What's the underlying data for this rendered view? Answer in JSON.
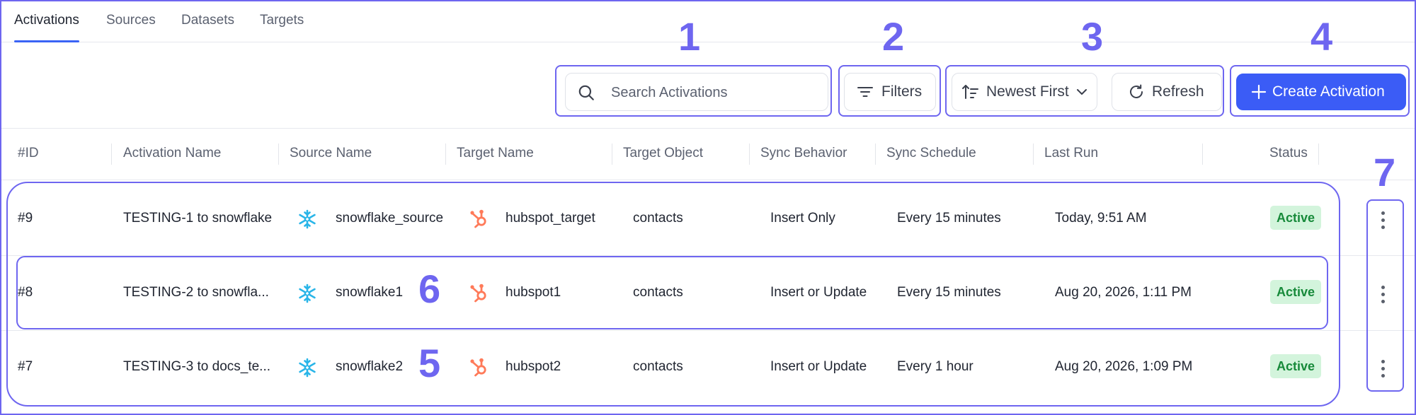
{
  "tabs": [
    {
      "label": "Activations",
      "active": true
    },
    {
      "label": "Sources",
      "active": false
    },
    {
      "label": "Datasets",
      "active": false
    },
    {
      "label": "Targets",
      "active": false
    }
  ],
  "toolbar": {
    "search_placeholder": "Search Activations",
    "filters_label": "Filters",
    "sort_label": "Newest First",
    "refresh_label": "Refresh",
    "create_label": "Create Activation"
  },
  "annotations": [
    "1",
    "2",
    "3",
    "4",
    "5",
    "6",
    "7"
  ],
  "table": {
    "columns": [
      "#ID",
      "Activation Name",
      "Source Name",
      "Target Name",
      "Target Object",
      "Sync Behavior",
      "Sync Schedule",
      "Last Run",
      "Status"
    ],
    "rows": [
      {
        "id": "#9",
        "name": "TESTING-1 to snowflake",
        "source": "snowflake_source",
        "target": "hubspot_target",
        "object": "contacts",
        "behavior": "Insert Only",
        "schedule": "Every 15 minutes",
        "last_run": "Today, 9:51 AM",
        "status": "Active"
      },
      {
        "id": "#8",
        "name": "TESTING-2 to snowfla...",
        "source": "snowflake1",
        "target": "hubspot1",
        "object": "contacts",
        "behavior": "Insert or Update",
        "schedule": "Every 15 minutes",
        "last_run": "Aug 20, 2026, 1:11 PM",
        "status": "Active"
      },
      {
        "id": "#7",
        "name": "TESTING-3 to docs_te...",
        "source": "snowflake2",
        "target": "hubspot2",
        "object": "contacts",
        "behavior": "Insert or Update",
        "schedule": "Every 1 hour",
        "last_run": "Aug 20, 2026, 1:09 PM",
        "status": "Active"
      }
    ]
  },
  "icons": {
    "search": "search-icon",
    "filters": "filter-lines-icon",
    "sort": "sort-arrow-icon",
    "chevron": "chevron-down-icon",
    "refresh": "refresh-icon",
    "create": "plus-icon",
    "source": "snowflake-icon",
    "target": "hubspot-icon",
    "row_menu": "kebab-menu-icon"
  },
  "colors": {
    "accent": "#3b5cf6",
    "annotation": "#6e66f0",
    "snowflake": "#29b5e8",
    "hubspot": "#ff7a59",
    "status_bg": "#d3f4dc",
    "status_text": "#178a3a"
  }
}
